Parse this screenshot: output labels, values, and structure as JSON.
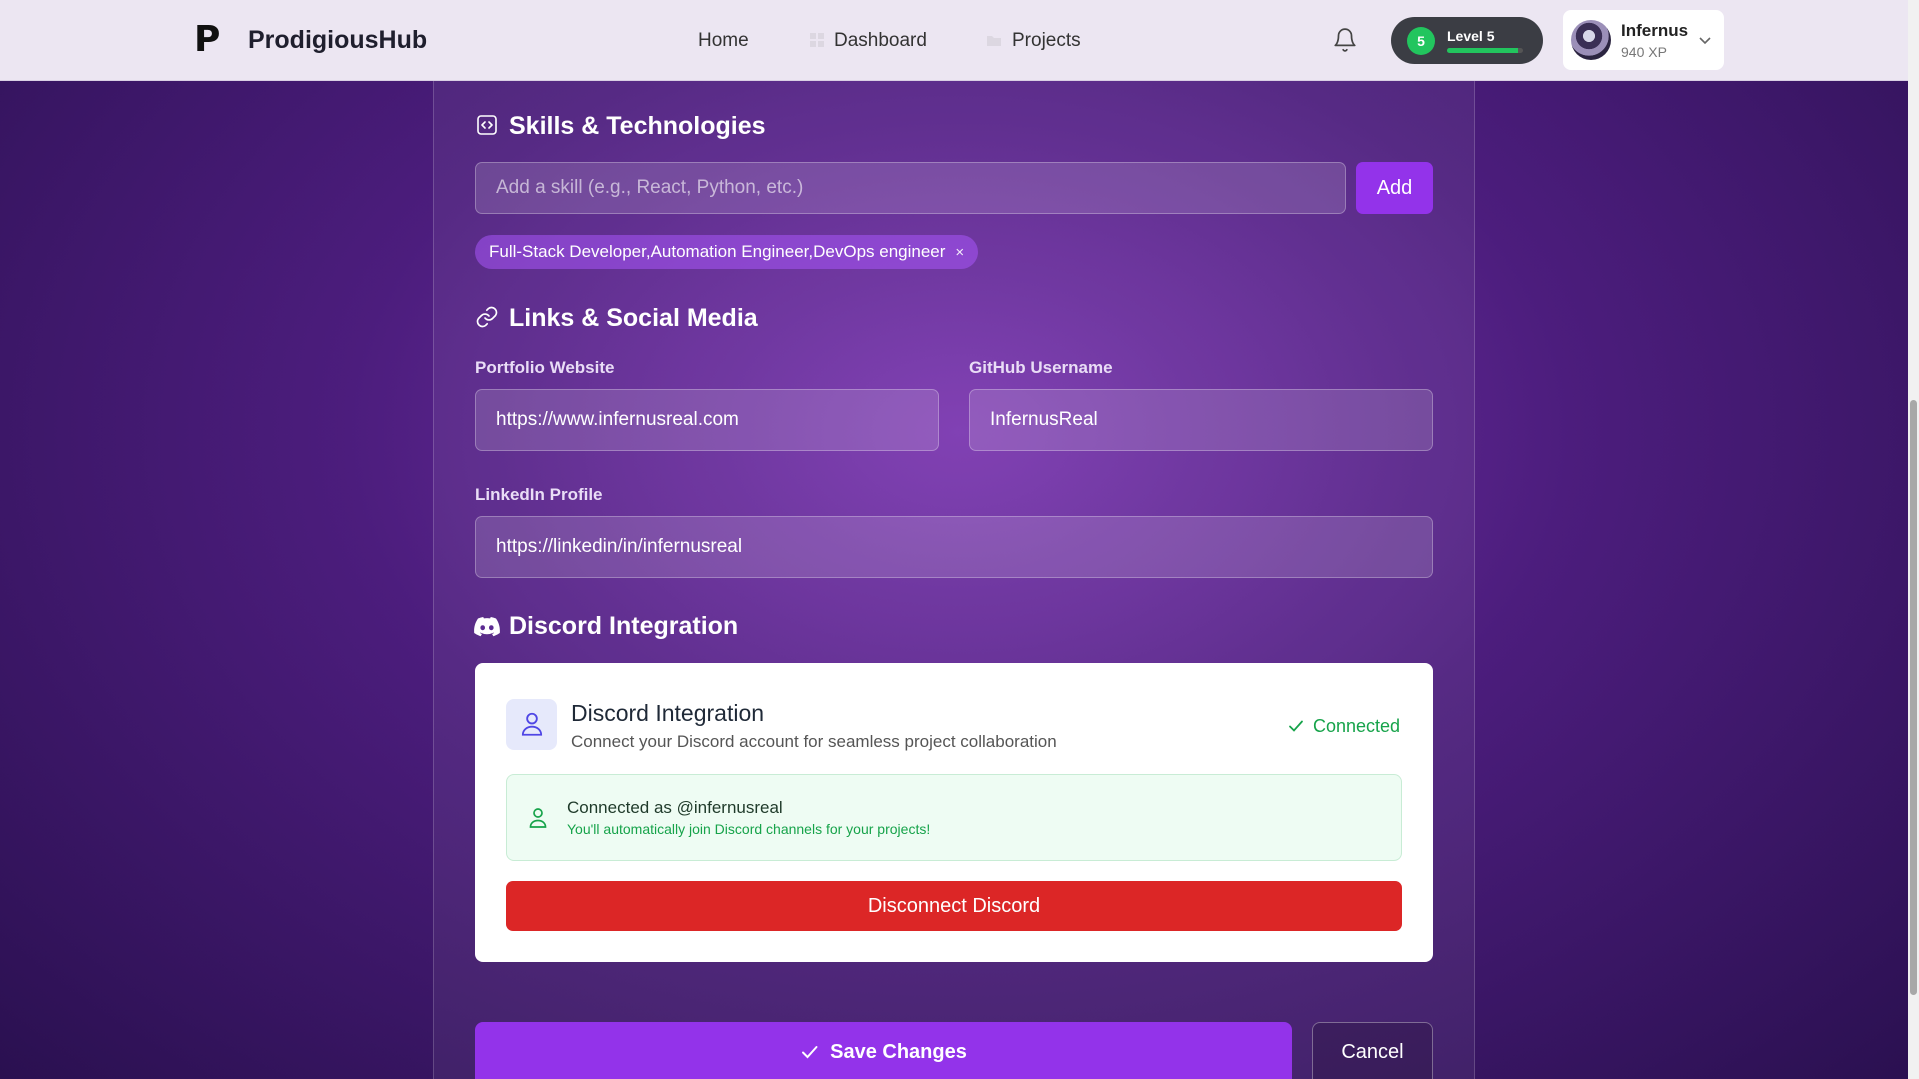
{
  "header": {
    "logo_letter": "P",
    "brand": "ProdigiousHub",
    "nav": [
      "Home",
      "Dashboard",
      "Projects"
    ],
    "level": {
      "number": "5",
      "label": "Level 5",
      "progress_fraction": 0.94
    },
    "user": {
      "name": "Infernus",
      "xp": "940 XP"
    }
  },
  "skills": {
    "title": "Skills & Technologies",
    "input_placeholder": "Add a skill (e.g., React, Python, etc.)",
    "add_label": "Add",
    "tags": [
      "Full-Stack Developer,Automation Engineer,DevOps engineer"
    ],
    "tag_remove": "×"
  },
  "links": {
    "title": "Links & Social Media",
    "portfolio_label": "Portfolio Website",
    "portfolio_value": "https://www.infernusreal.com",
    "github_label": "GitHub Username",
    "github_value": "InfernusReal",
    "linkedin_label": "LinkedIn Profile",
    "linkedin_value": "https://linkedin/in/infernusreal"
  },
  "discord": {
    "section_title": "Discord Integration",
    "card_title": "Discord Integration",
    "card_subtitle": "Connect your Discord account for seamless project collaboration",
    "status": "Connected",
    "connected_as": "Connected as @infernusreal",
    "connected_note": "You'll automatically join Discord channels for your projects!",
    "disconnect_label": "Disconnect Discord"
  },
  "actions": {
    "save_label": "Save Changes",
    "cancel_label": "Cancel"
  },
  "colors": {
    "accent": "#9333ea",
    "success": "#16a34a",
    "danger": "#dc2626"
  }
}
